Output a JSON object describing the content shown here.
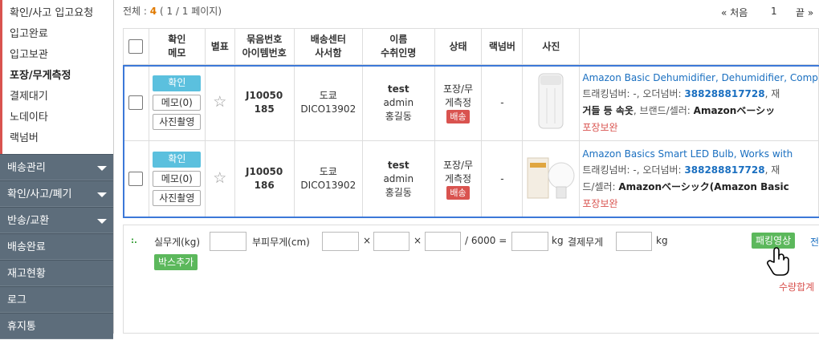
{
  "sidebar": {
    "sub_items": [
      "확인/사고 입고요청",
      "입고완료",
      "입고보관",
      "포장/무게측정",
      "결제대기",
      "노데이타",
      "랙넘버"
    ],
    "main_items": [
      {
        "label": "배송관리",
        "caret": true
      },
      {
        "label": "확인/사고/폐기",
        "caret": true
      },
      {
        "label": "반송/교환",
        "caret": true
      },
      {
        "label": "배송완료",
        "caret": false
      },
      {
        "label": "재고현황",
        "caret": false
      },
      {
        "label": "로그",
        "caret": false
      },
      {
        "label": "휴지통",
        "caret": false
      }
    ]
  },
  "summary": {
    "prefix": "전체 :",
    "count": "4",
    "pages": "( 1 / 1 페이지)"
  },
  "pager": {
    "first": "« 처음",
    "current": "1",
    "last": "끝 »"
  },
  "table": {
    "headers": {
      "confirm_1": "확인",
      "confirm_2": "메모",
      "star": "별표",
      "bundle_1": "묶음번호",
      "bundle_2": "아이템번호",
      "center_1": "배송센터",
      "center_2": "사서함",
      "name_1": "이름",
      "name_2": "수취인명",
      "status": "상태",
      "rack": "랙넘버",
      "photo": "사진"
    },
    "rows": [
      {
        "btn_confirm": "확인",
        "btn_memo": "메모(0)",
        "btn_photo": "사진촬영",
        "bundle_1": "J10050",
        "bundle_2": "185",
        "center": "도쿄",
        "mailbox": "DICO13902",
        "name_top": "test",
        "name_mid": "admin",
        "receiver": "홍길동",
        "status_1": "포장/무",
        "status_2": "게측정",
        "status_badge": "배송",
        "rack": "-",
        "product_link": "Amazon Basic Dehumidifier, Dehumidifier, Comp",
        "tracking_prefix": "트래킹넘버: -, 오더넘버: ",
        "tracking_number": "388288817728",
        "tracking_suffix": ", 재",
        "line2_bold": "거들 등 속옷",
        "line2_text": ", 브랜드/셀러: ",
        "line2_seller": "Amazonベーシッ",
        "keep": "포장보완"
      },
      {
        "btn_confirm": "확인",
        "btn_memo": "메모(0)",
        "btn_photo": "사진촬영",
        "bundle_1": "J10050",
        "bundle_2": "186",
        "center": "도쿄",
        "mailbox": "DICO13902",
        "name_top": "test",
        "name_mid": "admin",
        "receiver": "홍길동",
        "status_1": "포장/무",
        "status_2": "게측정",
        "status_badge": "배송",
        "rack": "-",
        "product_link": "Amazon Basics Smart LED Bulb, Works with",
        "tracking_prefix": "트래킹넘버: -, 오더넘버: ",
        "tracking_number": "388288817728",
        "tracking_suffix": ", 재",
        "line2_bold": "",
        "line2_text": "드/셀러: ",
        "line2_seller": "Amazonベーシック(Amazon Basic",
        "keep": "포장보완"
      }
    ]
  },
  "bottom": {
    "dots": ":.",
    "actual_weight_label": "실무게(kg)",
    "volume_label": "부피무게(cm)",
    "times": "×",
    "divisor": "/ 6000 =",
    "kg": "kg",
    "pay_weight_label": "결제무게",
    "add_box": "박스추가",
    "packing_video": "패킹영상",
    "right_cut": "전",
    "qty_total": "수량합계"
  },
  "colors": {
    "sidebar_bg": "#5d6d7b",
    "sub_accent": "#d9534f",
    "confirm_btn": "#5bc0de",
    "green_btn": "#5cb85c",
    "row_outline": "#3c78d8",
    "link": "#1a6fc0"
  }
}
